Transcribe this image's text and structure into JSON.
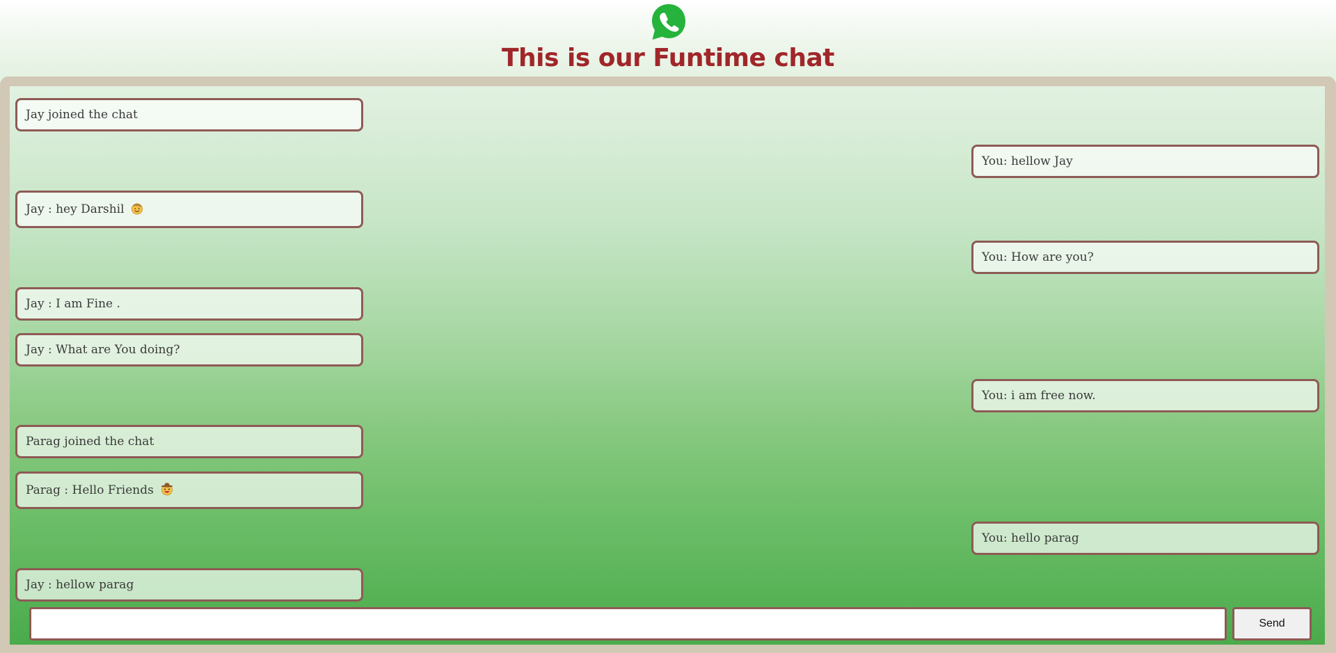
{
  "header": {
    "logo_icon": "whatsapp-icon",
    "title": "This is our Funtime chat",
    "title_color": "#a0262a",
    "brand_color": "#25b33b"
  },
  "messages": [
    {
      "side": "left",
      "text": "Jay joined the chat",
      "emoji": null
    },
    {
      "side": "right",
      "text": "You: hellow Jay",
      "emoji": null
    },
    {
      "side": "left",
      "text": "Jay : hey Darshil",
      "emoji": "smiling-face-emoji"
    },
    {
      "side": "right",
      "text": "You: How are you?",
      "emoji": null
    },
    {
      "side": "left",
      "text": "Jay : I am Fine .",
      "emoji": null
    },
    {
      "side": "left",
      "text": "Jay : What are You doing?",
      "emoji": null
    },
    {
      "side": "right",
      "text": "You: i am free now.",
      "emoji": null
    },
    {
      "side": "left",
      "text": "Parag joined the chat",
      "emoji": null
    },
    {
      "side": "left",
      "text": "Parag : Hello Friends",
      "emoji": "cowboy-face-emoji"
    },
    {
      "side": "right",
      "text": "You: hello parag",
      "emoji": null
    },
    {
      "side": "left",
      "text": "Jay : hellow parag",
      "emoji": null
    }
  ],
  "composer": {
    "input_value": "",
    "input_placeholder": "",
    "send_label": "Send"
  },
  "colors": {
    "bubble_border": "#8e5a55",
    "frame": "#d2c8b6",
    "chat_bg_top": "#e2f1e1",
    "chat_bg_bottom": "#4aab4b"
  }
}
